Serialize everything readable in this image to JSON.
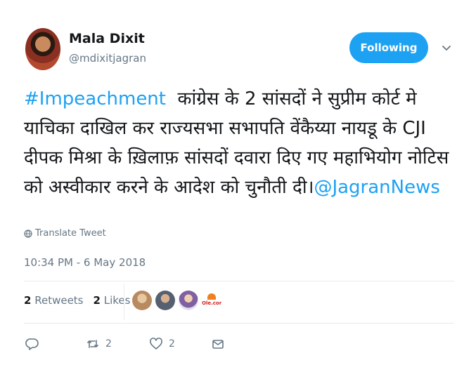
{
  "user": {
    "name": "Mala Dixit",
    "handle": "@mdixitjagran"
  },
  "follow_button": {
    "label": "Following"
  },
  "tweet": {
    "hashtag": "#Impeachment",
    "body": "  कांग्रेस के 2 सांसदों ने सुप्रीम कोर्ट मे याचिका दाखिल कर राज्यसभा सभापति वेंकैय्या नायडू के CJI दीपक मिश्रा के ख़िलाफ़ सांसदों दवारा दिए गए महाभियोग नोटिस को अस्वीकार करने के आदेश को चुनौती दी।",
    "mention": "@JagranNews",
    "translate_label": "Translate Tweet",
    "timestamp": "10:34 PM - 6 May 2018"
  },
  "stats": {
    "retweets_count": "2",
    "retweets_label": "Retweets",
    "likes_count": "2",
    "likes_label": "Likes"
  },
  "liker_logo_text": "Ole.com",
  "actions": {
    "reply_icon": "reply-icon",
    "retweet_icon": "retweet-icon",
    "retweet_count": "2",
    "like_icon": "heart-icon",
    "like_count": "2",
    "message_icon": "envelope-icon"
  },
  "colors": {
    "accent": "#1da1f2",
    "text": "#14171a",
    "muted": "#657786",
    "border": "#e6ecf0"
  }
}
